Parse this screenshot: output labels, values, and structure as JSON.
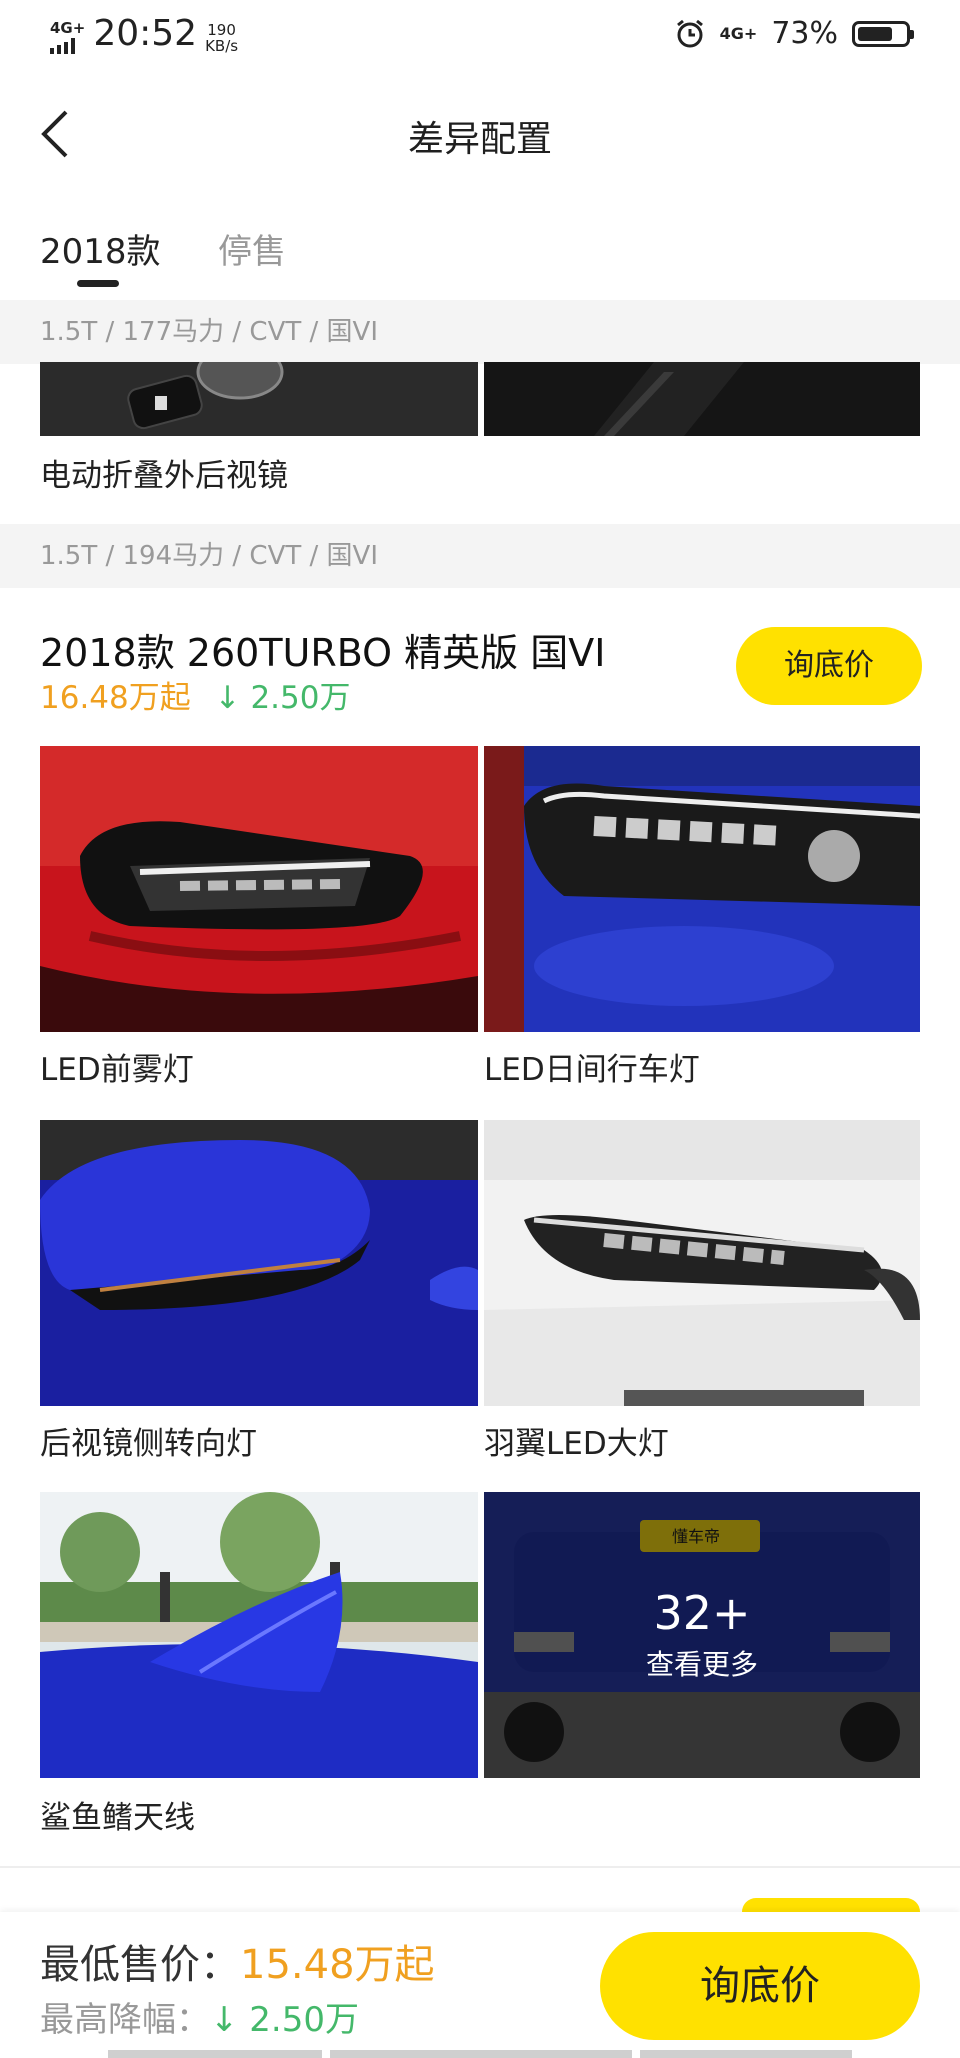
{
  "status_bar": {
    "network_left": "4G+",
    "time": "20:52",
    "speed_value": "190",
    "speed_unit": "KB/s",
    "network_right": "4G+",
    "battery_percent": "73%",
    "battery_level": 0.73,
    "icons": [
      "signal-icon",
      "alarm-icon",
      "battery-icon"
    ]
  },
  "header": {
    "title": "差异配置",
    "back_icon": "chevron-left-icon"
  },
  "tabs": [
    {
      "label": "2018款",
      "active": true
    },
    {
      "label": "停售",
      "active": false
    }
  ],
  "sections": [
    {
      "spec": "1.5T / 177马力 / CVT / 国VI",
      "features": [
        {
          "label": "电动折叠外后视镜"
        }
      ]
    },
    {
      "spec": "1.5T / 194马力 / CVT / 国VI",
      "model_name": "2018款 260TURBO 精英版 国VI",
      "price_start": "16.48万起",
      "price_drop": "↓ 2.50万",
      "inquire_label": "询底价",
      "features": [
        {
          "label": "LED前雾灯"
        },
        {
          "label": "LED日间行车灯"
        },
        {
          "label": "后视镜侧转向灯"
        },
        {
          "label": "羽翼LED大灯"
        },
        {
          "label": "鲨鱼鳍天线"
        }
      ],
      "more": {
        "count": "32+",
        "label": "查看更多",
        "badge_text": "懂车帝"
      }
    }
  ],
  "bottom_bar": {
    "min_price_label": "最低售价：",
    "min_price_value": "15.48万起",
    "max_drop_label": "最高降幅：",
    "max_drop_value": "↓ 2.50万",
    "button_label": "询底价"
  },
  "colors": {
    "accent_yellow": "#ffe100",
    "price_orange": "#f0a020",
    "drop_green": "#44b86a"
  }
}
